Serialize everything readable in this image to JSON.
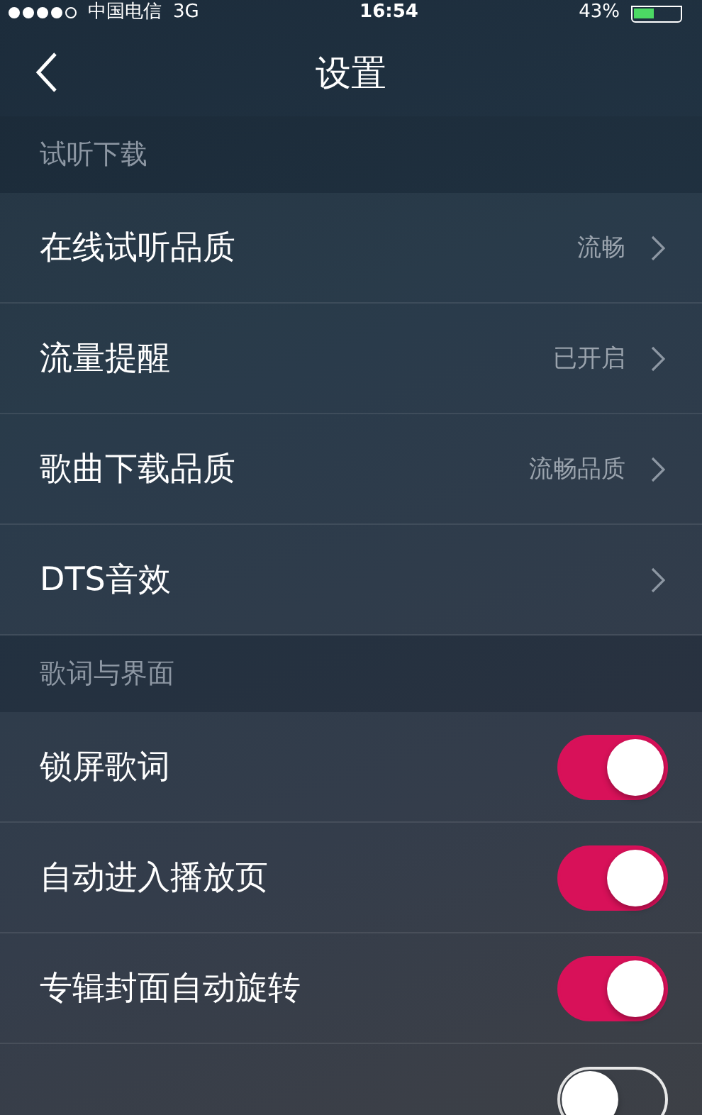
{
  "status_bar": {
    "carrier": "中国电信",
    "network": "3G",
    "time": "16:54",
    "battery": "43%"
  },
  "nav": {
    "title": "设置"
  },
  "sections": [
    {
      "header": "试听下载",
      "rows": [
        {
          "kind": "link",
          "label": "在线试听品质",
          "value": "流畅"
        },
        {
          "kind": "link",
          "label": "流量提醒",
          "value": "已开启"
        },
        {
          "kind": "link",
          "label": "歌曲下载品质",
          "value": "流畅品质"
        },
        {
          "kind": "link",
          "label": "DTS音效"
        }
      ]
    },
    {
      "header": "歌词与界面",
      "rows": [
        {
          "kind": "toggle",
          "label": "锁屏歌词",
          "on": true
        },
        {
          "kind": "toggle",
          "label": "自动进入播放页",
          "on": true
        },
        {
          "kind": "toggle",
          "label": "专辑封面自动旋转",
          "on": true
        },
        {
          "kind": "toggle",
          "on": false
        }
      ]
    }
  ]
}
